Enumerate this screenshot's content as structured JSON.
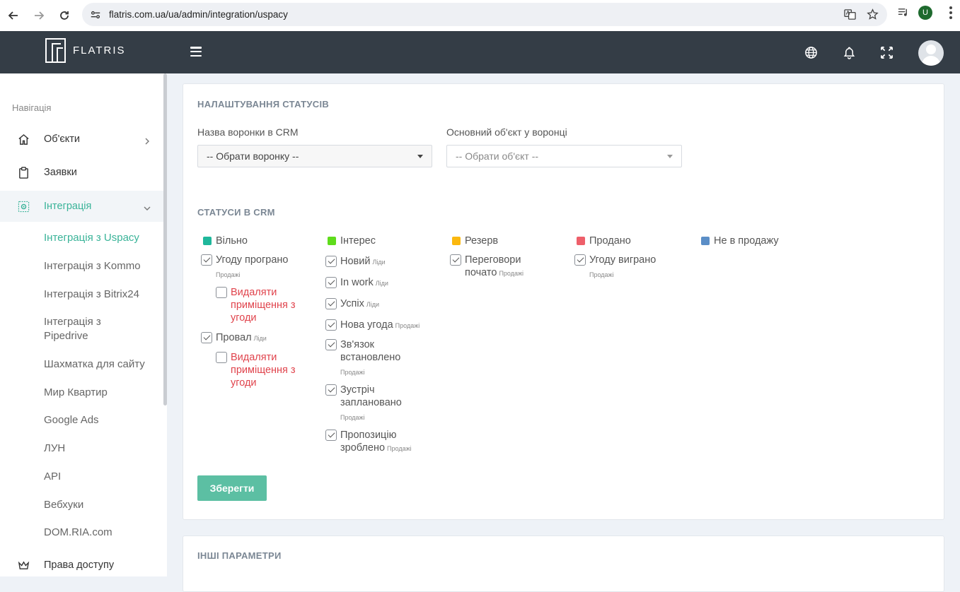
{
  "browser": {
    "url": "flatris.com.ua/ua/admin/integration/uspacy",
    "profile_initial": "U"
  },
  "header": {
    "logo_text": "FLATRIS"
  },
  "sidebar": {
    "heading": "Навігація",
    "items": [
      {
        "label": "Об'єкти",
        "icon": "home-icon"
      },
      {
        "label": "Заявки",
        "icon": "clipboard-icon"
      },
      {
        "label": "Інтеграція",
        "icon": "integration-icon"
      },
      {
        "label": "Права доступу",
        "icon": "crown-icon"
      }
    ],
    "sub_items": [
      "Інтеграція з Uspacy",
      "Інтеграція з Kommo",
      "Інтеграція з Bitrix24",
      "Інтеграція з Pipedrive",
      "Шахматка для сайту",
      "Мир Квартир",
      "Google Ads",
      "ЛУН",
      "API",
      "Вебхуки",
      "DOM.RIA.com"
    ]
  },
  "settings": {
    "title": "НАЛАШТУВАННЯ СТАТУСІВ",
    "funnel_label": "Назва воронки в CRM",
    "funnel_value": "-- Обрати воронку --",
    "object_label": "Основний об'єкт у воронці",
    "object_value": "-- Обрати об'єкт --",
    "statuses_title": "СТАТУСИ В CRM",
    "save_label": "Зберегти"
  },
  "statuses": [
    {
      "name": "Вільно",
      "color": "#1fb79b",
      "items": [
        {
          "label": "Угоду програно",
          "tag": "Продажі",
          "checked": true
        },
        {
          "label": "Видаляти приміщення з угоди",
          "checked": false,
          "sub": true
        },
        {
          "label": "Провал",
          "tag": "Ліди",
          "checked": true
        },
        {
          "label": "Видаляти приміщення з угоди",
          "checked": false,
          "sub": true
        }
      ]
    },
    {
      "name": "Інтерес",
      "color": "#5fdc1c",
      "items": [
        {
          "label": "Новий",
          "tag": "Ліди",
          "checked": true
        },
        {
          "label": "In work",
          "tag": "Ліди",
          "checked": true
        },
        {
          "label": "Успіх",
          "tag": "Ліди",
          "checked": true
        },
        {
          "label": "Нова угода",
          "tag": "Продажі",
          "checked": true
        },
        {
          "label": "Зв'язок встановлено",
          "tag": "Продажі",
          "checked": true
        },
        {
          "label": "Зустріч заплановано",
          "tag": "Продажі",
          "checked": true
        },
        {
          "label": "Пропозицію зроблено",
          "tag": "Продажі",
          "checked": true
        }
      ]
    },
    {
      "name": "Резерв",
      "color": "#fbb80f",
      "items": [
        {
          "label": "Переговори почато",
          "tag": "Продажі",
          "checked": true
        }
      ]
    },
    {
      "name": "Продано",
      "color": "#ee5f6a",
      "items": [
        {
          "label": "Угоду виграно",
          "tag": "Продажі",
          "checked": true
        }
      ]
    },
    {
      "name": "Не в продажу",
      "color": "#5b8ec7",
      "items": []
    }
  ],
  "other": {
    "title": "ІНШІ ПАРАМЕТРИ"
  }
}
